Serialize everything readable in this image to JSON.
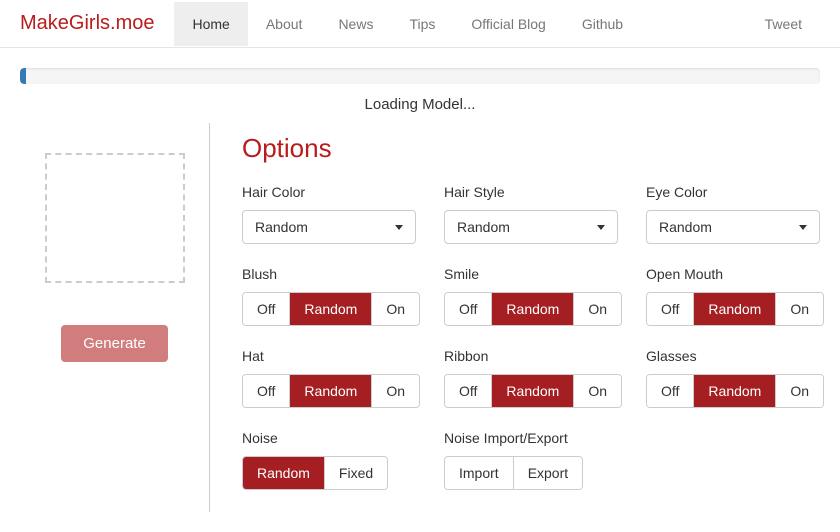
{
  "brand": "MakeGirls.moe",
  "nav": [
    "Home",
    "About",
    "News",
    "Tips",
    "Official Blog",
    "Github"
  ],
  "nav_active": 0,
  "nav_right": "Tweet",
  "loading": "Loading Model...",
  "generate": "Generate",
  "options_title": "Options",
  "dropdowns": {
    "hair_color": {
      "label": "Hair Color",
      "value": "Random"
    },
    "hair_style": {
      "label": "Hair Style",
      "value": "Random"
    },
    "eye_color": {
      "label": "Eye Color",
      "value": "Random"
    }
  },
  "toggles": {
    "off": "Off",
    "random": "Random",
    "on": "On",
    "blush": {
      "label": "Blush",
      "selected": "Random"
    },
    "smile": {
      "label": "Smile",
      "selected": "Random"
    },
    "open_mouth": {
      "label": "Open Mouth",
      "selected": "Random"
    },
    "hat": {
      "label": "Hat",
      "selected": "Random"
    },
    "ribbon": {
      "label": "Ribbon",
      "selected": "Random"
    },
    "glasses": {
      "label": "Glasses",
      "selected": "Random"
    }
  },
  "noise": {
    "label": "Noise",
    "random": "Random",
    "fixed": "Fixed",
    "selected": "Random"
  },
  "noise_io": {
    "label": "Noise Import/Export",
    "import": "Import",
    "export": "Export"
  }
}
